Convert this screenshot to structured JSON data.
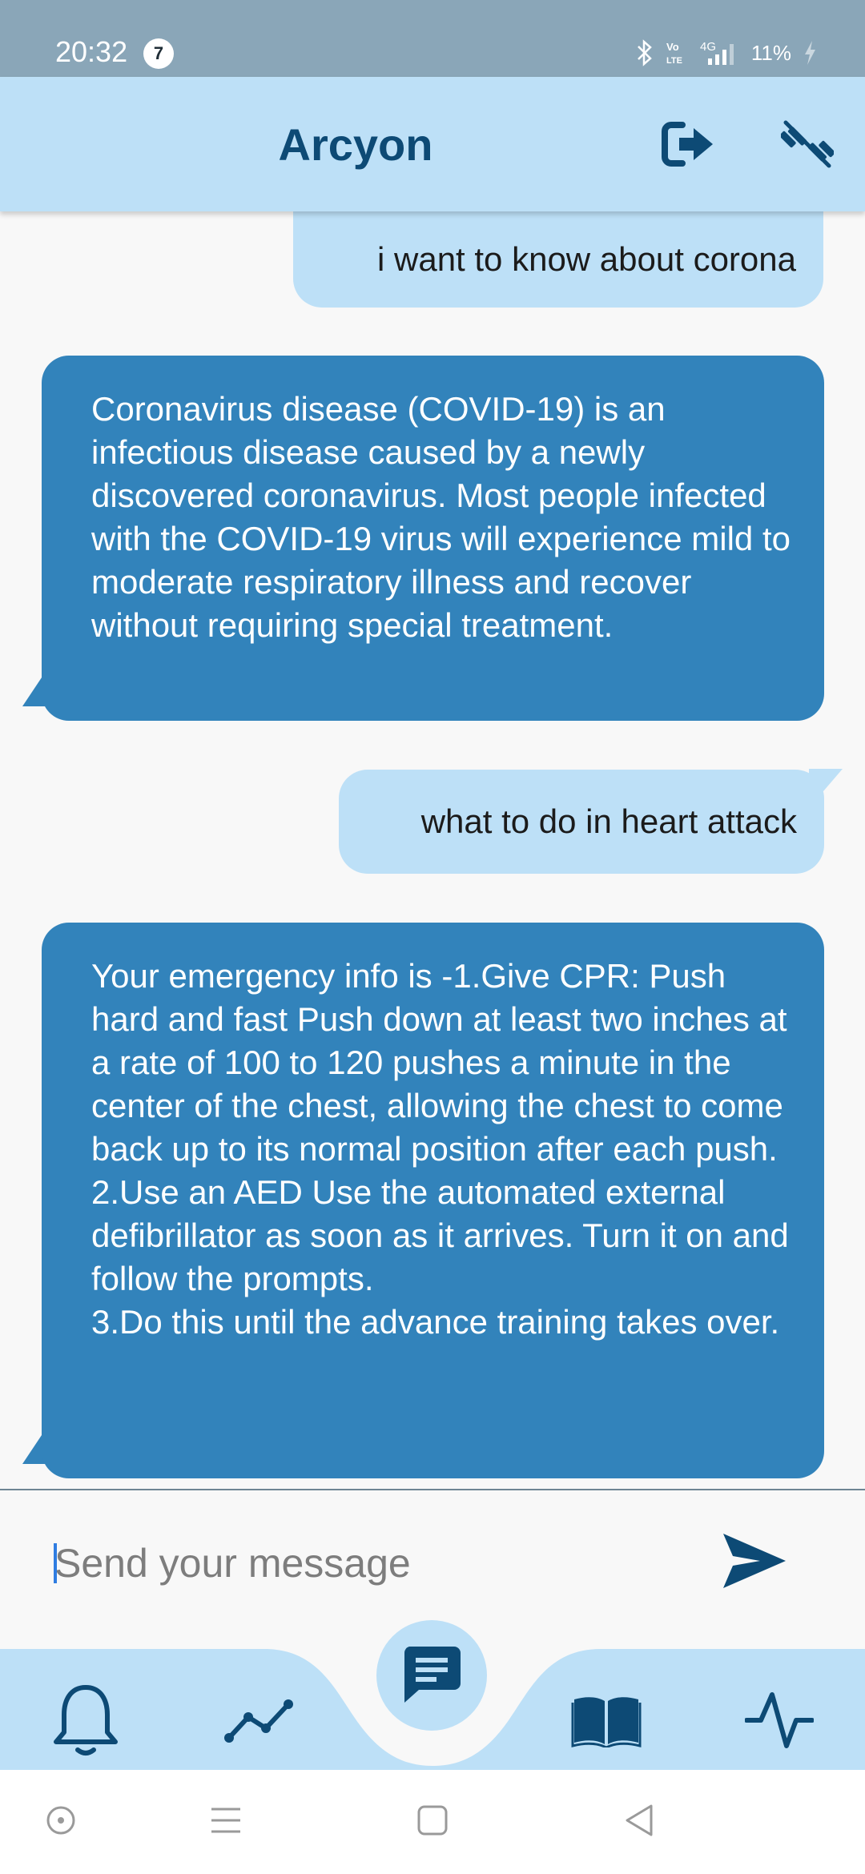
{
  "status_bar": {
    "time": "20:32",
    "notification_count": "7",
    "battery_percent": "11%",
    "network_label": "4G",
    "icons": [
      "bluetooth-icon",
      "volte-icon",
      "signal-icon",
      "battery-charging-icon"
    ]
  },
  "app_bar": {
    "title": "Arcyon",
    "actions": [
      "logout-icon",
      "fitness-icon"
    ]
  },
  "chat": {
    "messages": [
      {
        "sender": "user",
        "text": "i want to know about corona"
      },
      {
        "sender": "bot",
        "text": "Coronavirus disease (COVID-19) is an infectious disease caused by a newly discovered coronavirus. Most people infected with the COVID-19 virus will experience mild to moderate respiratory illness and recover without requiring special treatment."
      },
      {
        "sender": "user",
        "text": "what to do in heart attack"
      },
      {
        "sender": "bot",
        "text": "Your emergency info is -1.Give CPR: Push hard and fast Push down at least two inches at a rate of 100 to 120 pushes a minute in the center of the chest, allowing the chest to come back up to its normal position after each push.\n2.Use an AED Use the automated external defibrillator as soon as it arrives. Turn it on and follow the prompts.\n3.Do this until the advance training takes over."
      }
    ]
  },
  "composer": {
    "placeholder": "Send your message",
    "value": ""
  },
  "bottom_nav": {
    "items": [
      "notifications-icon",
      "analytics-icon",
      "chat-icon",
      "book-icon",
      "activity-icon"
    ],
    "selected": "chat-icon"
  },
  "system_nav": {
    "buttons": [
      "assistant-icon",
      "recents-icon",
      "home-icon",
      "back-icon"
    ]
  },
  "colors": {
    "status_bar": "#8aa6b8",
    "app_bar": "#bde0f7",
    "primary": "#0d4a75",
    "user_bubble": "#bde0f7",
    "bot_bubble": "#3283bb",
    "background": "#f8f8f8"
  }
}
